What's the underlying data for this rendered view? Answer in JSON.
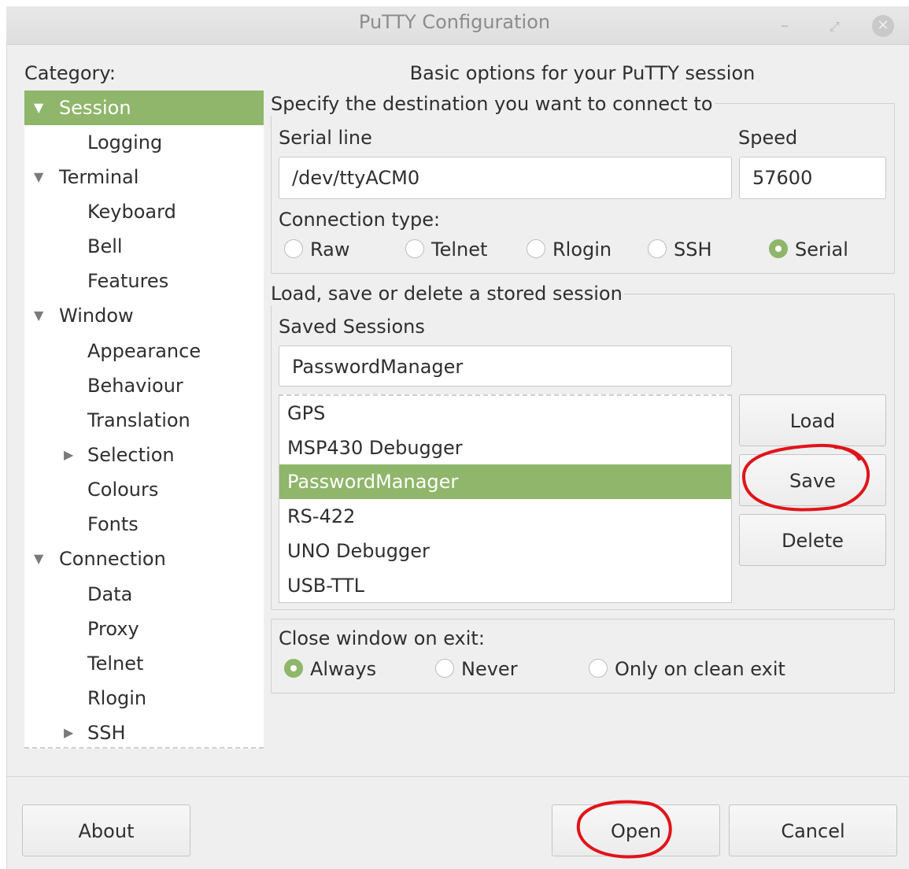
{
  "window": {
    "title": "PuTTY Configuration"
  },
  "category_label": "Category:",
  "tree": [
    {
      "label": "Session",
      "expanded": true,
      "selected": true,
      "level": 0
    },
    {
      "label": "Logging",
      "level": 1
    },
    {
      "label": "Terminal",
      "expanded": true,
      "level": 0
    },
    {
      "label": "Keyboard",
      "level": 1
    },
    {
      "label": "Bell",
      "level": 1
    },
    {
      "label": "Features",
      "level": 1
    },
    {
      "label": "Window",
      "expanded": true,
      "level": 0
    },
    {
      "label": "Appearance",
      "level": 1
    },
    {
      "label": "Behaviour",
      "level": 1
    },
    {
      "label": "Translation",
      "level": 1
    },
    {
      "label": "Selection",
      "collapsed": true,
      "level": 1
    },
    {
      "label": "Colours",
      "level": 1
    },
    {
      "label": "Fonts",
      "level": 1
    },
    {
      "label": "Connection",
      "expanded": true,
      "level": 0
    },
    {
      "label": "Data",
      "level": 1
    },
    {
      "label": "Proxy",
      "level": 1
    },
    {
      "label": "Telnet",
      "level": 1
    },
    {
      "label": "Rlogin",
      "level": 1
    },
    {
      "label": "SSH",
      "collapsed": true,
      "level": 1
    }
  ],
  "panel": {
    "heading": "Basic options for your PuTTY session",
    "destination": {
      "legend": "Specify the destination you want to connect to",
      "serial_line_label": "Serial line",
      "serial_line_value": "/dev/ttyACM0",
      "speed_label": "Speed",
      "speed_value": "57600",
      "connection_type_label": "Connection type:",
      "connection_types": [
        "Raw",
        "Telnet",
        "Rlogin",
        "SSH",
        "Serial"
      ],
      "selected_connection_type": "Serial"
    },
    "sessions": {
      "legend": "Load, save or delete a stored session",
      "saved_sessions_label": "Saved Sessions",
      "saved_sessions_value": "PasswordManager",
      "list": [
        "GPS",
        "MSP430 Debugger",
        "PasswordManager",
        "RS-422",
        "UNO Debugger",
        "USB-TTL"
      ],
      "selected": "PasswordManager",
      "load_label": "Load",
      "save_label": "Save",
      "delete_label": "Delete"
    },
    "close_on_exit": {
      "label": "Close window on exit:",
      "options": [
        "Always",
        "Never",
        "Only on clean exit"
      ],
      "selected": "Always"
    }
  },
  "footer": {
    "about_label": "About",
    "open_label": "Open",
    "cancel_label": "Cancel"
  },
  "colors": {
    "accent": "#8fb66a",
    "annotation": "#e0141a"
  }
}
